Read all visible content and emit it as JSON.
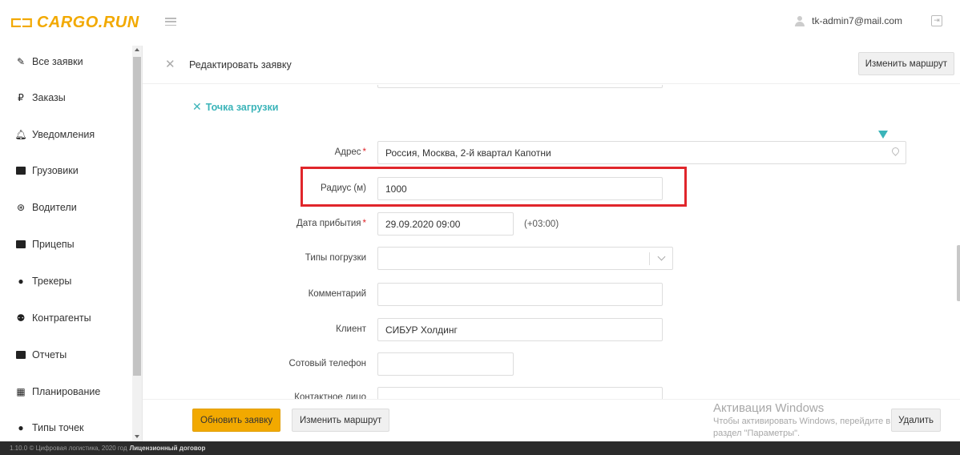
{
  "header": {
    "logo_text": "CARGO.RUN",
    "user_email": "tk-admin7@mail.com"
  },
  "sidebar": {
    "items": [
      {
        "label": "Все заявки",
        "icon": "pencil-square-icon"
      },
      {
        "label": "Заказы",
        "icon": "ruble-icon"
      },
      {
        "label": "Уведомления",
        "icon": "bell-icon"
      },
      {
        "label": "Грузовики",
        "icon": "truck-icon"
      },
      {
        "label": "Водители",
        "icon": "steering-wheel-icon"
      },
      {
        "label": "Прицепы",
        "icon": "trailer-icon"
      },
      {
        "label": "Трекеры",
        "icon": "map-pin-icon"
      },
      {
        "label": "Контрагенты",
        "icon": "users-icon"
      },
      {
        "label": "Отчеты",
        "icon": "report-icon"
      },
      {
        "label": "Планирование",
        "icon": "calendar-icon"
      },
      {
        "label": "Типы точек",
        "icon": "map-pin-icon"
      }
    ]
  },
  "panel": {
    "title": "Редактировать заявку",
    "change_route_top": "Изменить маршрут",
    "section_title": "Точка загрузки"
  },
  "form": {
    "address": {
      "label": "Адрес",
      "value": "Россия, Москва, 2-й квартал Капотни"
    },
    "radius": {
      "label": "Радиус (м)",
      "value": "1000"
    },
    "arrival": {
      "label": "Дата прибытия",
      "value": "29.09.2020 09:00",
      "tz": "(+03:00)"
    },
    "load_types": {
      "label": "Типы погрузки",
      "value": ""
    },
    "comment": {
      "label": "Комментарий",
      "value": ""
    },
    "client": {
      "label": "Клиент",
      "value": "СИБУР Холдинг"
    },
    "mobile": {
      "label": "Сотовый телефон",
      "value": ""
    },
    "contact_partial": {
      "label": "Контактное лицо"
    }
  },
  "footer": {
    "update_button": "Обновить заявку",
    "change_route_button": "Изменить маршрут",
    "delete_button": "Удалить"
  },
  "watermark": {
    "title": "Активация Windows",
    "line1": "Чтобы активировать Windows, перейдите в",
    "line2": "раздел \"Параметры\"."
  },
  "bottom": {
    "text": "1.10.0 © Цифровая логистика, 2020 год",
    "link": "Лицензионный договор"
  },
  "colors": {
    "accent": "#f2a900",
    "teal": "#3bb4b9",
    "highlight": "#e0262b"
  }
}
